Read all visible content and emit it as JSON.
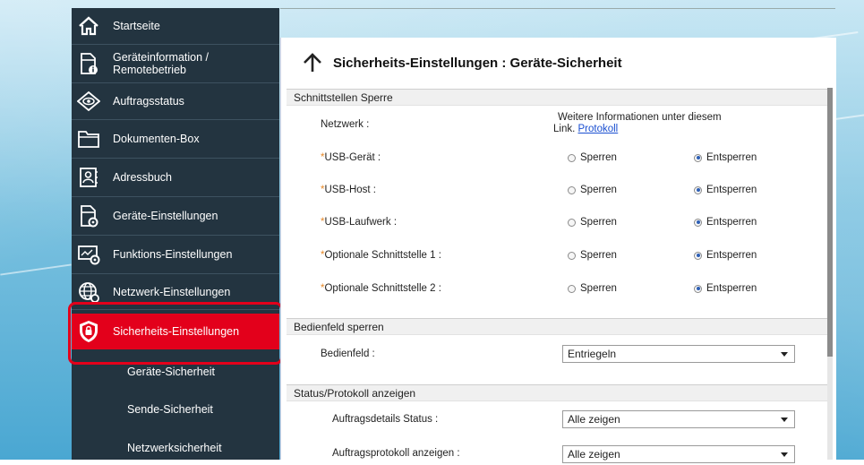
{
  "sidebar": {
    "items": [
      {
        "label": "Startseite",
        "icon": "home-icon"
      },
      {
        "label": "Geräteinformation / Remotebetrieb",
        "icon": "device-info-icon"
      },
      {
        "label": "Auftragsstatus",
        "icon": "eye-icon"
      },
      {
        "label": "Dokumenten-Box",
        "icon": "folder-icon"
      },
      {
        "label": "Adressbuch",
        "icon": "address-book-icon"
      },
      {
        "label": "Geräte-Einstellungen",
        "icon": "device-settings-icon"
      },
      {
        "label": "Funktions-Einstellungen",
        "icon": "function-settings-icon"
      },
      {
        "label": "Netzwerk-Einstellungen",
        "icon": "network-globe-icon"
      },
      {
        "label": "Sicherheits-Einstellungen",
        "icon": "security-shield-icon"
      }
    ],
    "sub_items": [
      {
        "label": "Geräte-Sicherheit"
      },
      {
        "label": "Sende-Sicherheit"
      },
      {
        "label": "Netzwerksicherheit"
      }
    ],
    "active_color": "#e3001b"
  },
  "page": {
    "title": "Sicherheits-Einstellungen : Geräte-Sicherheit"
  },
  "interface_lock": {
    "section_title": "Schnittstellen Sperre",
    "network_label": "Netzwerk :",
    "network_info": "Weitere Informationen unter diesem",
    "network_info_prefix": "Link.",
    "network_link": "Protokoll",
    "required_marker": "*",
    "option_lock": "Sperren",
    "option_unlock": "Entsperren",
    "rows": [
      {
        "label": "USB-Gerät :",
        "selected": "Entsperren"
      },
      {
        "label": "USB-Host :",
        "selected": "Entsperren"
      },
      {
        "label": "USB-Laufwerk :",
        "selected": "Entsperren"
      },
      {
        "label": "Optionale Schnittstelle 1 :",
        "selected": "Entsperren"
      },
      {
        "label": "Optionale Schnittstelle 2 :",
        "selected": "Entsperren"
      }
    ]
  },
  "panel_lock": {
    "section_title": "Bedienfeld sperren",
    "label": "Bedienfeld :",
    "value": "Entriegeln"
  },
  "status_log": {
    "section_title": "Status/Protokoll anzeigen",
    "rows": [
      {
        "label": "Auftragsdetails Status :",
        "value": "Alle zeigen"
      },
      {
        "label": "Auftragsprotokoll anzeigen :",
        "value": "Alle zeigen"
      }
    ]
  }
}
